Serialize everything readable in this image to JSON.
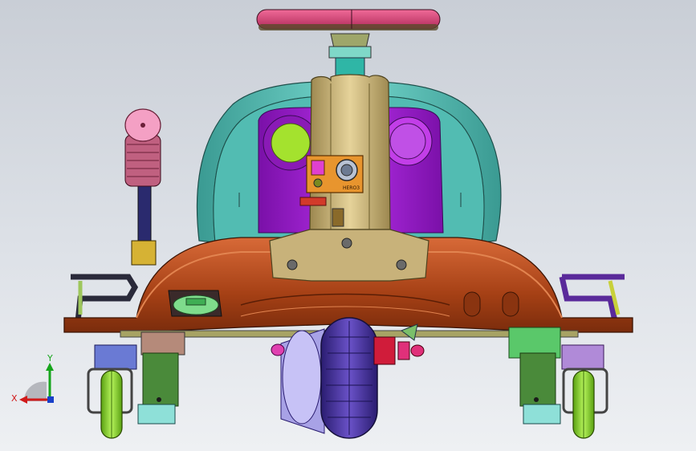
{
  "viewport": {
    "background_top": "#c9ced6",
    "background_bottom": "#eef0f3"
  },
  "triad": {
    "x_label": "X",
    "y_label": "Y",
    "x_color": "#d11a1a",
    "y_color": "#16a51c",
    "z_color": "#1840c8"
  },
  "model": {
    "camera_screen": {
      "brand": "HERO3"
    },
    "colors": {
      "steering_wheel": "#e0457a",
      "seat_shell": "#5cc7bd",
      "seat_back": "#a01ad6",
      "column": "#c9b47a",
      "frame": "#b04a1c",
      "left_grip": "#f4a0c4",
      "front_wheel": "#5a3fb0",
      "caster_wheel": "#8ee022",
      "left_indicator": "#a4e22e",
      "right_indicator": "#c050e6"
    }
  }
}
